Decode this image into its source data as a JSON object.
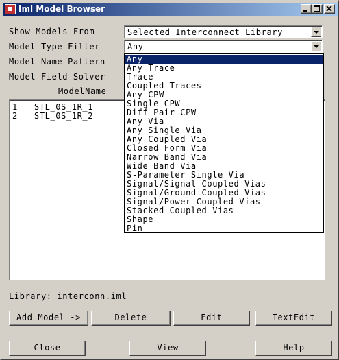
{
  "window": {
    "title": "Iml Model Browser"
  },
  "form": {
    "show_models_from": {
      "label": "Show Models From",
      "value": "Selected Interconnect Library"
    },
    "model_type_filter": {
      "label": "Model Type Filter",
      "value": "Any"
    },
    "model_name_pattern": {
      "label": "Model Name Pattern"
    },
    "model_field_solver": {
      "label": "Model Field Solver"
    }
  },
  "list": {
    "column_header": "ModelName",
    "rows": [
      {
        "num": "1",
        "name": "STL_0S_1R_1"
      },
      {
        "num": "2",
        "name": "STL_0S_1R_2"
      }
    ]
  },
  "dropdown": {
    "selected_index": 0,
    "options": [
      "Any",
      "Any Trace",
      "Trace",
      "Coupled Traces",
      "Any CPW",
      "Single CPW",
      "Diff Pair CPW",
      "Any Via",
      "Any Single Via",
      "Any Coupled Via",
      "Closed Form Via",
      "Narrow Band Via",
      "Wide Band Via",
      "S-Parameter Single Via",
      "Signal/Signal Coupled Vias",
      "Signal/Ground Coupled Vias",
      "Signal/Power Coupled Vias",
      "Stacked Coupled Vias",
      "Shape",
      "Pin"
    ]
  },
  "library": {
    "text": "Library: interconn.iml"
  },
  "buttons": {
    "add_model": "Add Model ->",
    "delete": "Delete",
    "edit": "Edit",
    "textedit": "TextEdit",
    "close": "Close",
    "view": "View",
    "help": "Help"
  },
  "icons": {
    "app": "app-icon",
    "minimize": "minimize-icon",
    "maximize": "maximize-icon",
    "close": "close-icon",
    "dropdown_arrow": "chevron-down-icon"
  },
  "colors": {
    "title_bar_start": "#0a246a",
    "title_bar_end": "#a6caf0",
    "selection": "#0a246a",
    "face": "#d4d0c8"
  }
}
